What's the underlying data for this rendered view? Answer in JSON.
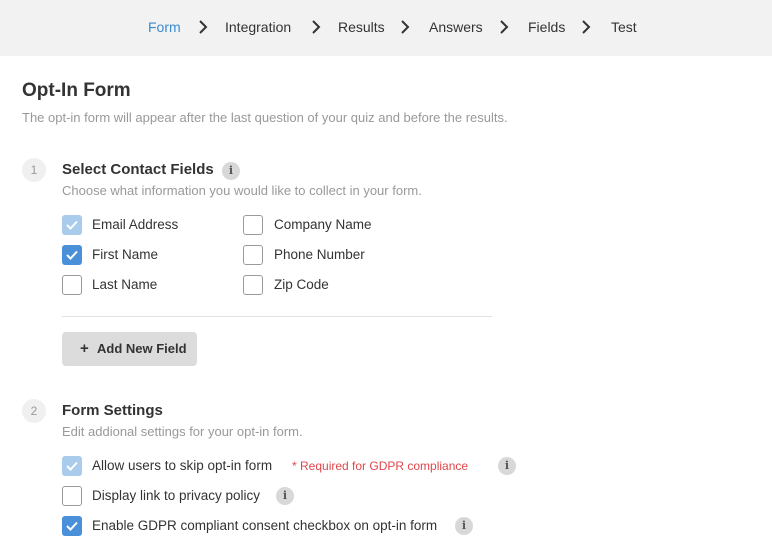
{
  "breadcrumb": {
    "items": [
      {
        "label": "Form",
        "active": true
      },
      {
        "label": "Integration",
        "active": false
      },
      {
        "label": "Results",
        "active": false
      },
      {
        "label": "Answers",
        "active": false
      },
      {
        "label": "Fields",
        "active": false
      },
      {
        "label": "Test",
        "active": false
      }
    ]
  },
  "header": {
    "title": "Opt-In Form",
    "subtitle": "The opt-in form will appear after the last question of your quiz and before the results."
  },
  "section1": {
    "number": "1",
    "title": "Select Contact Fields",
    "subtitle": "Choose what information you would like to collect in your form.",
    "info_icon": "i",
    "fields": [
      {
        "label": "Email Address",
        "checked": true,
        "locked": true
      },
      {
        "label": "First Name",
        "checked": true,
        "locked": false
      },
      {
        "label": "Last Name",
        "checked": false,
        "locked": false
      },
      {
        "label": "Company Name",
        "checked": false,
        "locked": false
      },
      {
        "label": "Phone Number",
        "checked": false,
        "locked": false
      },
      {
        "label": "Zip Code",
        "checked": false,
        "locked": false
      }
    ],
    "add_button_icon": "+",
    "add_button": "Add New Field"
  },
  "section2": {
    "number": "2",
    "title": "Form Settings",
    "subtitle": "Edit addional settings for your opt-in form.",
    "settings": [
      {
        "label": "Allow users to skip opt-in form",
        "checked": true,
        "locked": true,
        "note": "* Required for GDPR compliance"
      },
      {
        "label": "Display link to privacy policy",
        "checked": false,
        "locked": false
      },
      {
        "label": "Enable GDPR compliant consent checkbox on opt-in form",
        "checked": true,
        "locked": false
      }
    ],
    "info_icon": "i"
  },
  "colors": {
    "accent": "#3a8ad0",
    "checkbox_checked": "#4a90d9",
    "checkbox_disabled": "#a9cbec",
    "required": "#e0474c",
    "topbar": "#f2f2f2"
  }
}
